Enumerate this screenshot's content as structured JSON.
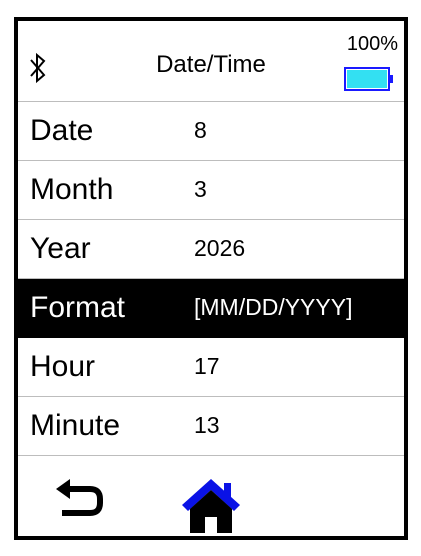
{
  "header": {
    "title": "Date/Time",
    "battery_percent_label": "100%",
    "battery_level": 1.0,
    "bluetooth_icon": "bluetooth-icon",
    "battery_color": "#33e0f2",
    "battery_border_color": "#1a1aff"
  },
  "rows": [
    {
      "label": "Date",
      "value": "8",
      "selected": false
    },
    {
      "label": "Month",
      "value": "3",
      "selected": false
    },
    {
      "label": "Year",
      "value": "2026",
      "selected": false
    },
    {
      "label": "Format",
      "value": "[MM/DD/YYYY]",
      "selected": true
    },
    {
      "label": "Hour",
      "value": "17",
      "selected": false
    },
    {
      "label": "Minute",
      "value": "13",
      "selected": false
    }
  ],
  "footer": {
    "back_icon": "back-arrow-icon",
    "home_icon": "home-icon",
    "home_color": "#0a12e6"
  }
}
